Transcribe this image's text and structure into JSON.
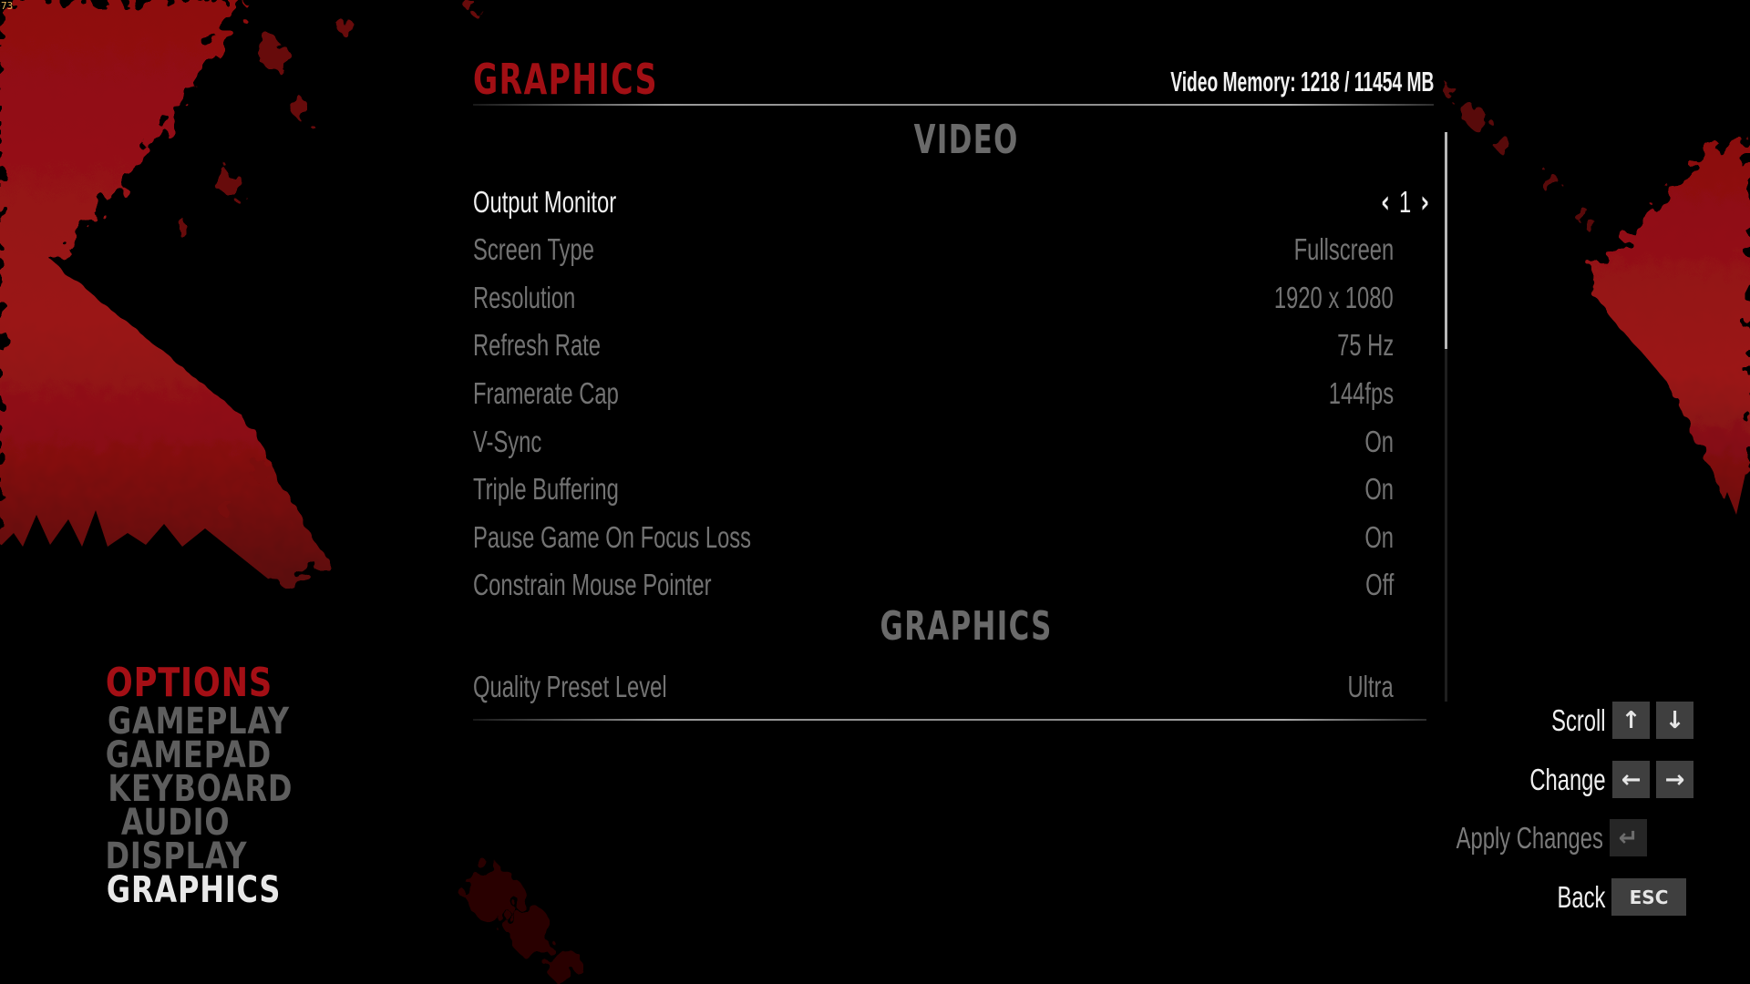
{
  "overlay": {
    "fps_counter": "73"
  },
  "header": {
    "title": "GRAPHICS",
    "video_memory": "Video Memory: 1218 / 11454 MB"
  },
  "sections": {
    "video": "VIDEO",
    "graphics": "GRAPHICS"
  },
  "settings": [
    {
      "label": "Output Monitor",
      "value": "1",
      "selected": true
    },
    {
      "label": "Screen Type",
      "value": "Fullscreen"
    },
    {
      "label": "Resolution",
      "value": "1920 x 1080"
    },
    {
      "label": "Refresh Rate",
      "value": "75 Hz"
    },
    {
      "label": "Framerate Cap",
      "value": "144fps"
    },
    {
      "label": "V-Sync",
      "value": "On"
    },
    {
      "label": "Triple Buffering",
      "value": "On"
    },
    {
      "label": "Pause Game On Focus Loss",
      "value": "On"
    },
    {
      "label": "Constrain Mouse Pointer",
      "value": "Off"
    },
    {
      "label": "Quality Preset Level",
      "value": "Ultra"
    }
  ],
  "selector_icons": {
    "prev": "‹",
    "next": "›"
  },
  "scroll": {
    "visible_fraction": 0.38,
    "position_fraction": 0.0
  },
  "side_menu": {
    "heading": "OPTIONS",
    "items": [
      {
        "label": "GAMEPLAY"
      },
      {
        "label": "GAMEPAD"
      },
      {
        "label": "KEYBOARD"
      },
      {
        "label": "AUDIO"
      },
      {
        "label": "DISPLAY"
      },
      {
        "label": "GRAPHICS",
        "active": true
      }
    ]
  },
  "hints": {
    "scroll": {
      "label": "Scroll",
      "keys": [
        "↑",
        "↓"
      ]
    },
    "change": {
      "label": "Change",
      "keys": [
        "←",
        "→"
      ]
    },
    "apply": {
      "label": "Apply Changes",
      "key": "↵",
      "disabled": true
    },
    "back": {
      "label": "Back",
      "key": "ESC"
    }
  },
  "colors": {
    "accent_red": "#a10f14",
    "background": "#000000",
    "text_active": "#f0f0f0",
    "text_inactive": "#737373"
  }
}
